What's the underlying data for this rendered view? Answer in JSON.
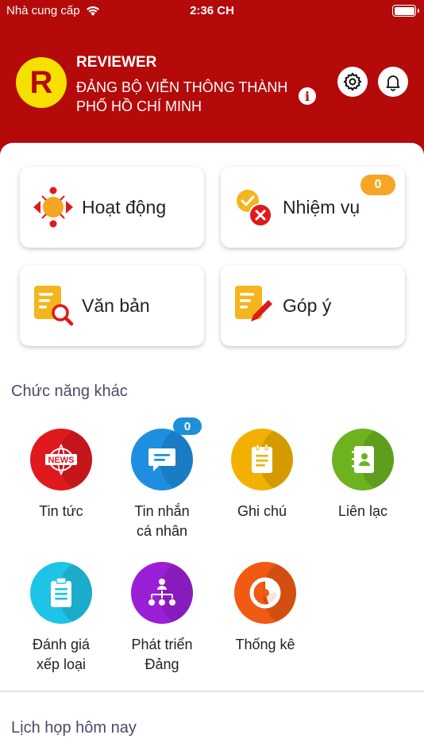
{
  "status_bar": {
    "carrier": "Nhà cung cấp",
    "time": "2:36 CH"
  },
  "header": {
    "avatar_letter": "R",
    "user_name": "REVIEWER",
    "organization": "ĐẢNG BỘ VIỄN THÔNG THÀNH PHỐ HỒ CHÍ MINH",
    "info_glyph": "i"
  },
  "main_cards": [
    {
      "label": "Hoạt động",
      "icon": "activity-icon"
    },
    {
      "label": "Nhiệm vụ",
      "icon": "task-icon",
      "badge": "0"
    },
    {
      "label": "Văn bản",
      "icon": "document-search-icon"
    },
    {
      "label": "Góp ý",
      "icon": "feedback-icon"
    }
  ],
  "other_functions": {
    "title": "Chức năng khác",
    "items": [
      {
        "line1": "Tin tức",
        "line2": "",
        "icon": "news-icon",
        "color": "#e0191e"
      },
      {
        "line1": "Tin nhắn",
        "line2": "cá nhân",
        "icon": "message-icon",
        "color": "#1e8fe0",
        "badge": "0"
      },
      {
        "line1": "Ghi chú",
        "line2": "",
        "icon": "note-icon",
        "color": "#f2b100"
      },
      {
        "line1": "Liên lạc",
        "line2": "",
        "icon": "contacts-icon",
        "color": "#6db320"
      },
      {
        "line1": "Đánh giá",
        "line2": "xếp loại",
        "icon": "evaluation-icon",
        "color": "#1ec4e6"
      },
      {
        "line1": "Phát triển",
        "line2": "Đảng",
        "icon": "party-growth-icon",
        "color": "#9b1fd6"
      },
      {
        "line1": "Thống kê",
        "line2": "",
        "icon": "statistics-icon",
        "color": "#f05a12"
      }
    ]
  },
  "meetings": {
    "title": "Lịch họp hôm nay"
  }
}
